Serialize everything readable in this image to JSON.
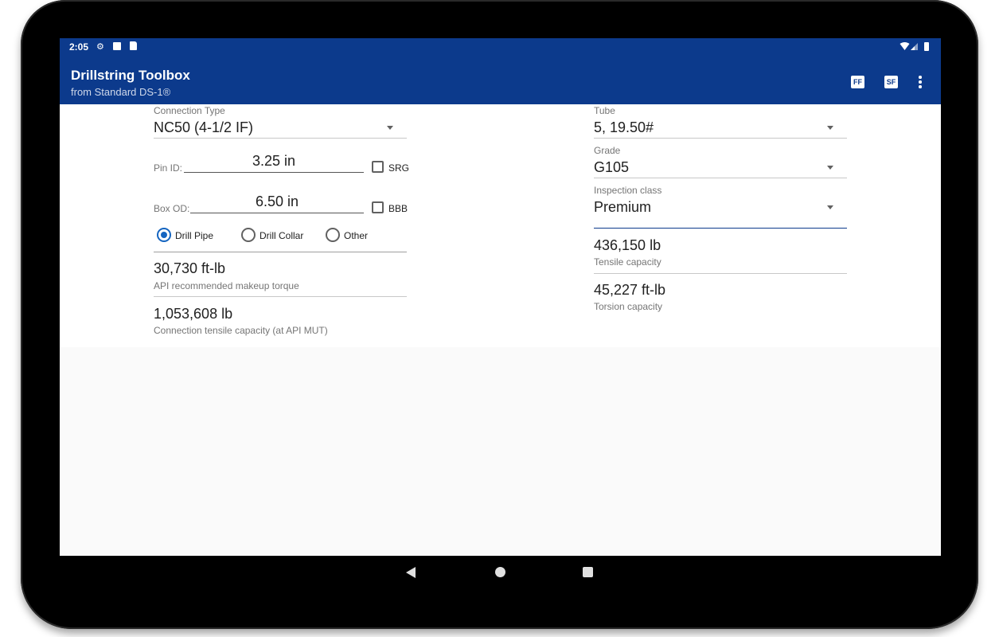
{
  "status": {
    "time": "2:05",
    "icons": [
      "gear-icon",
      "a-icon",
      "sd-card-icon",
      "wifi-icon",
      "cell-signal-icon",
      "battery-icon"
    ]
  },
  "appbar": {
    "title": "Drillstring Toolbox",
    "subtitle": "from Standard DS-1®",
    "actions": [
      {
        "name": "ff-icon",
        "label": "FF"
      },
      {
        "name": "sf-icon",
        "label": "SF"
      }
    ]
  },
  "left": {
    "connection_type_label": "Connection Type",
    "connection_type_value": "NC50 (4-1/2 IF)",
    "pin_id_label": "Pin ID:",
    "pin_id_value": "3.25 in",
    "srg_label": "SRG",
    "box_od_label": "Box OD:",
    "box_od_value": "6.50 in",
    "bbb_label": "BBB",
    "radio_options": [
      {
        "label": "Drill Pipe",
        "selected": true
      },
      {
        "label": "Drill Collar",
        "selected": false
      },
      {
        "label": "Other",
        "selected": false
      }
    ],
    "makeup_torque_value": "30,730 ft-lb",
    "makeup_torque_label": "API recommended makeup torque",
    "conn_tensile_value": "1,053,608 lb",
    "conn_tensile_label": "Connection tensile capacity (at API MUT)"
  },
  "right": {
    "tube_label": "Tube",
    "tube_value": "5, 19.50#",
    "grade_label": "Grade",
    "grade_value": "G105",
    "inspection_label": "Inspection class",
    "inspection_value": "Premium",
    "tensile_value": "436,150 lb",
    "tensile_label": "Tensile capacity",
    "torsion_value": "45,227 ft-lb",
    "torsion_label": "Torsion capacity"
  },
  "colors": {
    "appbar": "#0c3a8c",
    "accent": "#1565c0",
    "background": "#fafafa"
  }
}
